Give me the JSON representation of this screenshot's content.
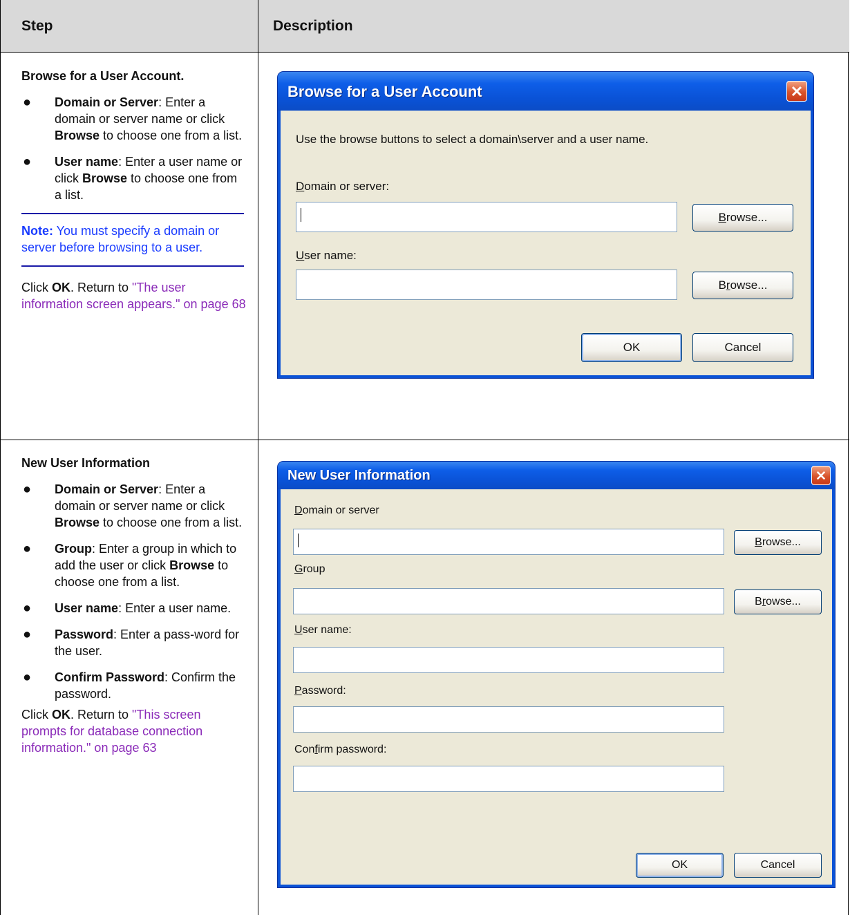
{
  "table": {
    "header_step": "Step",
    "header_description": "Description"
  },
  "row1": {
    "title": "Browse for a User Account.",
    "bullets": [
      {
        "term": "Domain or Server",
        "pre": ": Enter a domain or server name or click ",
        "bold2": "Browse",
        "post": " to choose one from a list."
      },
      {
        "term": "User name",
        "pre": ": Enter a user name or click ",
        "bold2": "Browse",
        "post": " to choose one from a list."
      }
    ],
    "note_label": "Note:",
    "note_text": " You must specify a domain or server before browsing to a user.",
    "click_pre": "Click ",
    "click_ok": "OK",
    "click_mid": ". Return to ",
    "link_text": "\"The user information screen appears.\" on page 68"
  },
  "row2": {
    "title": "New User Information",
    "bullets": [
      {
        "term": "Domain or Server",
        "pre": ": Enter a domain or server name or click ",
        "bold2": "Browse",
        "post": " to choose one from a list."
      },
      {
        "term": "Group",
        "pre": ": Enter a group in which to add the user or click ",
        "bold2": "Browse",
        "post": " to choose one from a list."
      },
      {
        "term": "User name",
        "pre": ": Enter a user name.",
        "bold2": "",
        "post": ""
      },
      {
        "term": "Password",
        "pre": ": Enter a pass-word for the user.",
        "bold2": "",
        "post": ""
      },
      {
        "term": "Confirm Password",
        "pre": ": Confirm the password.",
        "bold2": "",
        "post": ""
      }
    ],
    "click_pre": "Click ",
    "click_ok": "OK",
    "click_mid": ". Return to ",
    "link_text": "\"This screen prompts for database connection information.\" on page 63"
  },
  "dialog1": {
    "title": "Browse for a User Account",
    "instruction": "Use the browse buttons to select a domain\\server and a user name.",
    "domain_label_first": "D",
    "domain_label_rest": "omain or server:",
    "domain_value": "",
    "browse1_pre": "",
    "browse1_ul": "B",
    "browse1_post": "rowse...",
    "user_label_first": "U",
    "user_label_rest": "ser name:",
    "user_value": "",
    "browse2_pre": "B",
    "browse2_ul": "r",
    "browse2_post": "owse...",
    "ok_label": "OK",
    "cancel_label": "Cancel"
  },
  "dialog2": {
    "title": "New User Information",
    "domain_label_first": "D",
    "domain_label_rest": "omain or server",
    "group_label_first": "G",
    "group_label_rest": "roup",
    "user_label_first": "U",
    "user_label_rest": "ser name:",
    "password_label_first": "P",
    "password_label_rest": "assword:",
    "confirm_label_pre": "Con",
    "confirm_label_ul": "f",
    "confirm_label_post": "irm password:",
    "browse1_ul": "B",
    "browse1_post": "rowse...",
    "browse2_pre": "B",
    "browse2_ul": "r",
    "browse2_post": "owse...",
    "ok_label": "OK",
    "cancel_label": "Cancel"
  }
}
